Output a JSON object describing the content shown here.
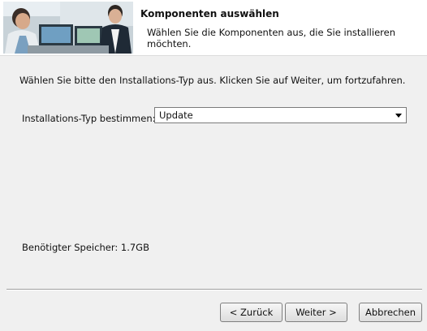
{
  "header": {
    "title": "Komponenten auswählen",
    "subtitle": "Wählen Sie die Komponenten aus, die Sie installieren möchten."
  },
  "instruction": "Wählen Sie bitte den Installations-Typ aus. Klicken Sie auf Weiter, um fortzufahren.",
  "install_type": {
    "label": "Installations-Typ bestimmen:",
    "selected": "Update"
  },
  "space_required": "Benötigter Speicher: 1.7GB",
  "buttons": {
    "back": "< Zurück",
    "next": "Weiter >",
    "cancel": "Abbrechen"
  }
}
